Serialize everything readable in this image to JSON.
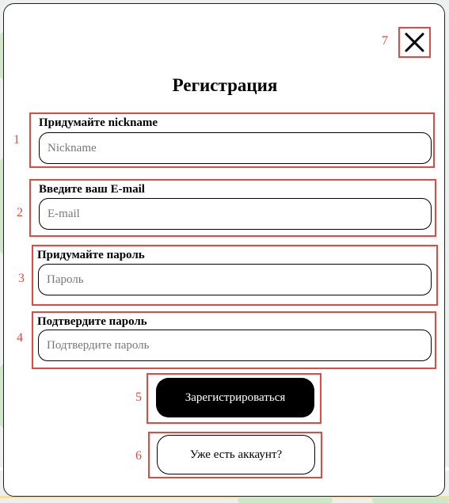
{
  "modal": {
    "title": "Регистрация",
    "close_icon": "close-icon"
  },
  "annotations": {
    "nickname": "1",
    "email": "2",
    "password": "3",
    "confirm": "4",
    "register": "5",
    "login": "6",
    "close": "7"
  },
  "fields": {
    "nickname": {
      "label": "Придумайте nickname",
      "placeholder": "Nickname",
      "value": ""
    },
    "email": {
      "label": "Введите ваш E-mail",
      "placeholder": "E-mail",
      "value": ""
    },
    "password": {
      "label": "Придумайте пароль",
      "placeholder": "Пароль",
      "value": ""
    },
    "confirm": {
      "label": "Подтвердите пароль",
      "placeholder": "Подтвердите пароль",
      "value": ""
    }
  },
  "buttons": {
    "register_label": "Зарегистрироваться",
    "login_label": "Уже есть аккаунт?"
  },
  "colors": {
    "annotation": "#e24a3f",
    "modal_bg": "#ffffff",
    "register_bg": "#000000"
  }
}
